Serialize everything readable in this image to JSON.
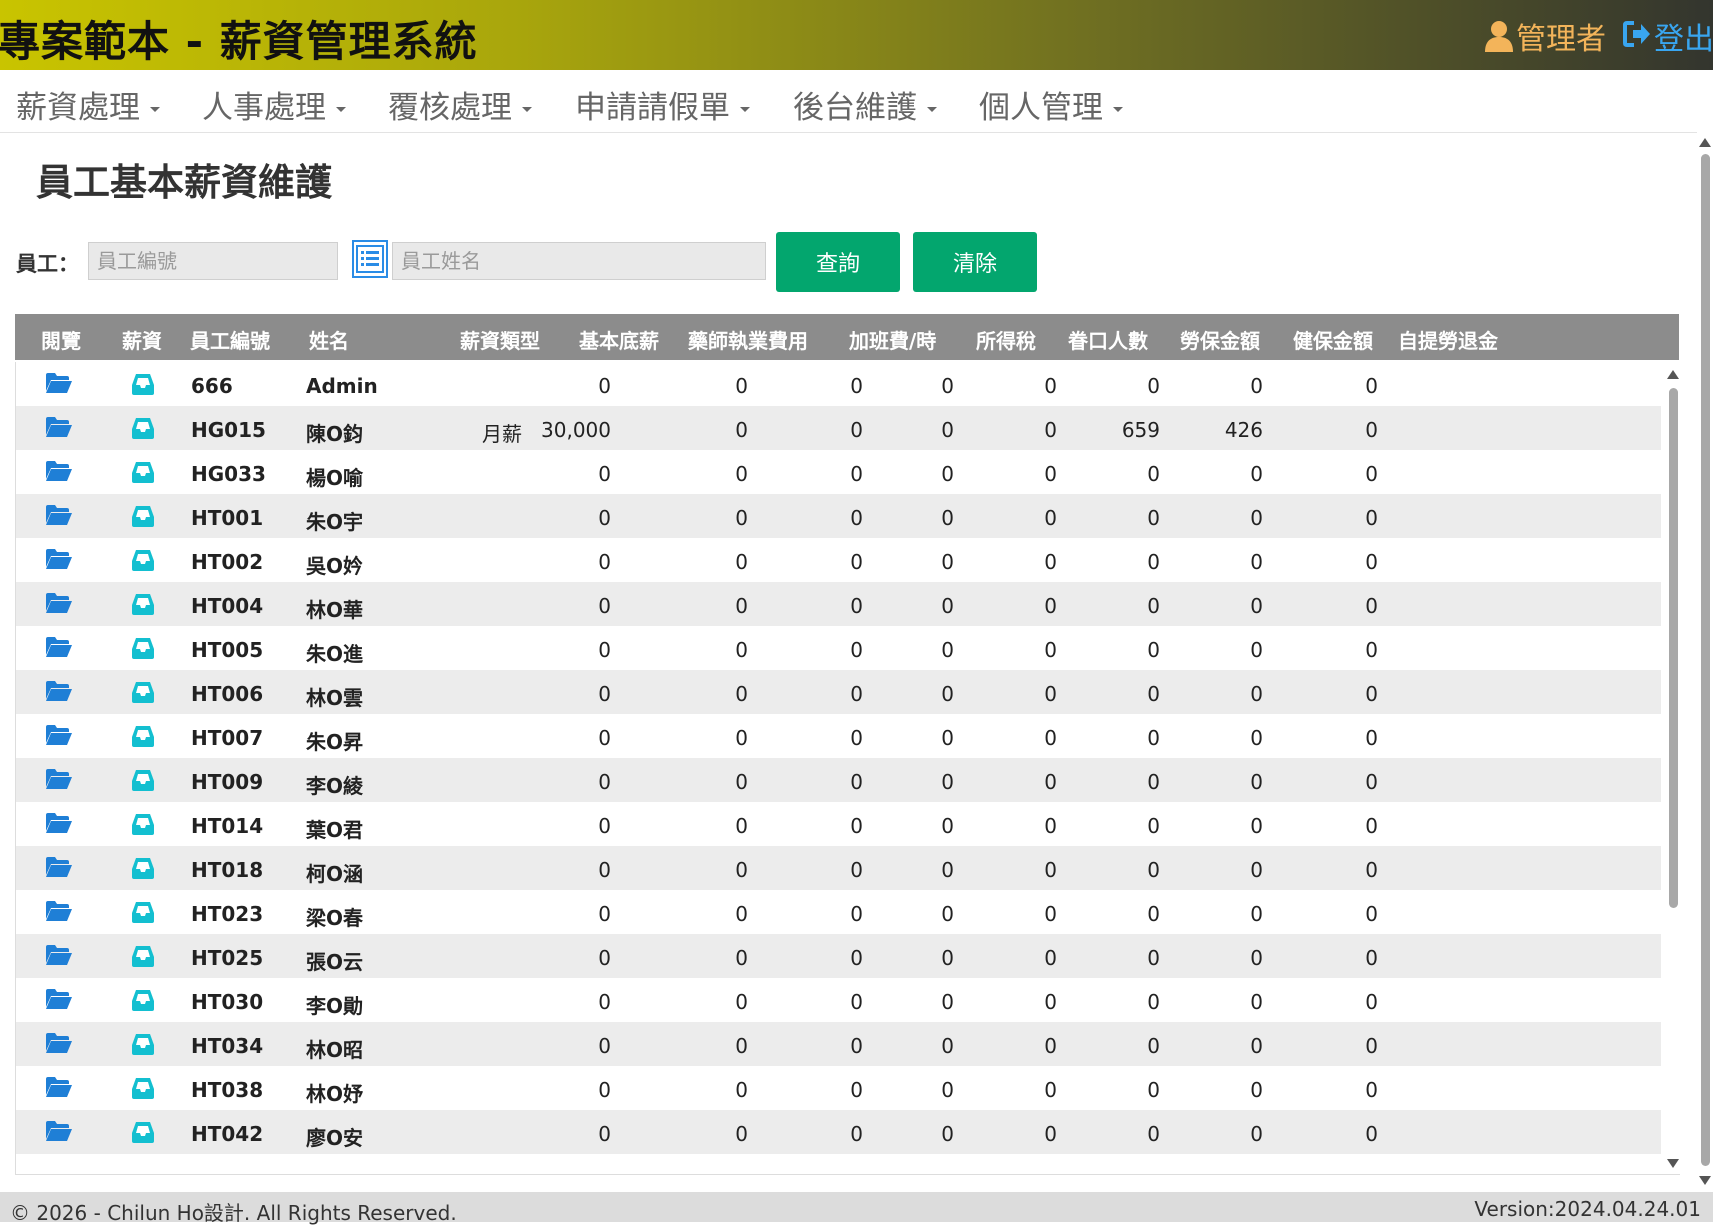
{
  "header": {
    "title": "專案範本 - 薪資管理系統",
    "user_label": "管理者",
    "logout_label": "登出"
  },
  "nav": {
    "items": [
      "薪資處理",
      "人事處理",
      "覆核處理",
      "申請請假單",
      "後台維護",
      "個人管理"
    ]
  },
  "page": {
    "title": "員工基本薪資維護"
  },
  "search": {
    "employee_label": "員工：",
    "id_placeholder": "員工編號",
    "name_placeholder": "員工姓名",
    "query_label": "查詢",
    "clear_label": "清除"
  },
  "table": {
    "headers": [
      "閱覽",
      "薪資",
      "員工編號",
      "姓名",
      "薪資類型",
      "基本底薪",
      "藥師執業費用",
      "加班費/時",
      "所得稅",
      "眷口人數",
      "勞保金額",
      "健保金額",
      "自提勞退金"
    ],
    "rows": [
      {
        "id": "666",
        "name": "Admin",
        "type": "",
        "base": "0",
        "pharm": "0",
        "ot": "0",
        "tax": "0",
        "dep": "0",
        "labor": "0",
        "health": "0",
        "pension": "0"
      },
      {
        "id": "HG015",
        "name": "陳O鈞",
        "type": "月薪",
        "base": "30,000",
        "pharm": "0",
        "ot": "0",
        "tax": "0",
        "dep": "0",
        "labor": "659",
        "health": "426",
        "pension": "0"
      },
      {
        "id": "HG033",
        "name": "楊O喻",
        "type": "",
        "base": "0",
        "pharm": "0",
        "ot": "0",
        "tax": "0",
        "dep": "0",
        "labor": "0",
        "health": "0",
        "pension": "0"
      },
      {
        "id": "HT001",
        "name": "朱O宇",
        "type": "",
        "base": "0",
        "pharm": "0",
        "ot": "0",
        "tax": "0",
        "dep": "0",
        "labor": "0",
        "health": "0",
        "pension": "0"
      },
      {
        "id": "HT002",
        "name": "吳O妗",
        "type": "",
        "base": "0",
        "pharm": "0",
        "ot": "0",
        "tax": "0",
        "dep": "0",
        "labor": "0",
        "health": "0",
        "pension": "0"
      },
      {
        "id": "HT004",
        "name": "林O華",
        "type": "",
        "base": "0",
        "pharm": "0",
        "ot": "0",
        "tax": "0",
        "dep": "0",
        "labor": "0",
        "health": "0",
        "pension": "0"
      },
      {
        "id": "HT005",
        "name": "朱O進",
        "type": "",
        "base": "0",
        "pharm": "0",
        "ot": "0",
        "tax": "0",
        "dep": "0",
        "labor": "0",
        "health": "0",
        "pension": "0"
      },
      {
        "id": "HT006",
        "name": "林O雲",
        "type": "",
        "base": "0",
        "pharm": "0",
        "ot": "0",
        "tax": "0",
        "dep": "0",
        "labor": "0",
        "health": "0",
        "pension": "0"
      },
      {
        "id": "HT007",
        "name": "朱O昇",
        "type": "",
        "base": "0",
        "pharm": "0",
        "ot": "0",
        "tax": "0",
        "dep": "0",
        "labor": "0",
        "health": "0",
        "pension": "0"
      },
      {
        "id": "HT009",
        "name": "李O綾",
        "type": "",
        "base": "0",
        "pharm": "0",
        "ot": "0",
        "tax": "0",
        "dep": "0",
        "labor": "0",
        "health": "0",
        "pension": "0"
      },
      {
        "id": "HT014",
        "name": "葉O君",
        "type": "",
        "base": "0",
        "pharm": "0",
        "ot": "0",
        "tax": "0",
        "dep": "0",
        "labor": "0",
        "health": "0",
        "pension": "0"
      },
      {
        "id": "HT018",
        "name": "柯O涵",
        "type": "",
        "base": "0",
        "pharm": "0",
        "ot": "0",
        "tax": "0",
        "dep": "0",
        "labor": "0",
        "health": "0",
        "pension": "0"
      },
      {
        "id": "HT023",
        "name": "梁O春",
        "type": "",
        "base": "0",
        "pharm": "0",
        "ot": "0",
        "tax": "0",
        "dep": "0",
        "labor": "0",
        "health": "0",
        "pension": "0"
      },
      {
        "id": "HT025",
        "name": "張O云",
        "type": "",
        "base": "0",
        "pharm": "0",
        "ot": "0",
        "tax": "0",
        "dep": "0",
        "labor": "0",
        "health": "0",
        "pension": "0"
      },
      {
        "id": "HT030",
        "name": "李O勛",
        "type": "",
        "base": "0",
        "pharm": "0",
        "ot": "0",
        "tax": "0",
        "dep": "0",
        "labor": "0",
        "health": "0",
        "pension": "0"
      },
      {
        "id": "HT034",
        "name": "林O昭",
        "type": "",
        "base": "0",
        "pharm": "0",
        "ot": "0",
        "tax": "0",
        "dep": "0",
        "labor": "0",
        "health": "0",
        "pension": "0"
      },
      {
        "id": "HT038",
        "name": "林O妤",
        "type": "",
        "base": "0",
        "pharm": "0",
        "ot": "0",
        "tax": "0",
        "dep": "0",
        "labor": "0",
        "health": "0",
        "pension": "0"
      },
      {
        "id": "HT042",
        "name": "廖O安",
        "type": "",
        "base": "0",
        "pharm": "0",
        "ot": "0",
        "tax": "0",
        "dep": "0",
        "labor": "0",
        "health": "0",
        "pension": "0"
      }
    ]
  },
  "icons": {
    "view": "folder-open-icon",
    "salary": "inbox-icon",
    "user": "user-icon",
    "logout": "sign-out-icon",
    "list": "list-icon"
  },
  "colors": {
    "header_start": "#c9c400",
    "header_end": "#33352e",
    "button": "#03a66e",
    "folder_icon": "#1f7fd6",
    "salary_icon": "#13bfd0",
    "user_icon": "#f3b45a",
    "logout": "#39a6f0",
    "table_header": "#8c8c8c"
  },
  "footer": {
    "copyright": "© 2026 - Chilun Ho設計. All Rights Reserved.",
    "version": "Version:2024.04.24.01"
  }
}
